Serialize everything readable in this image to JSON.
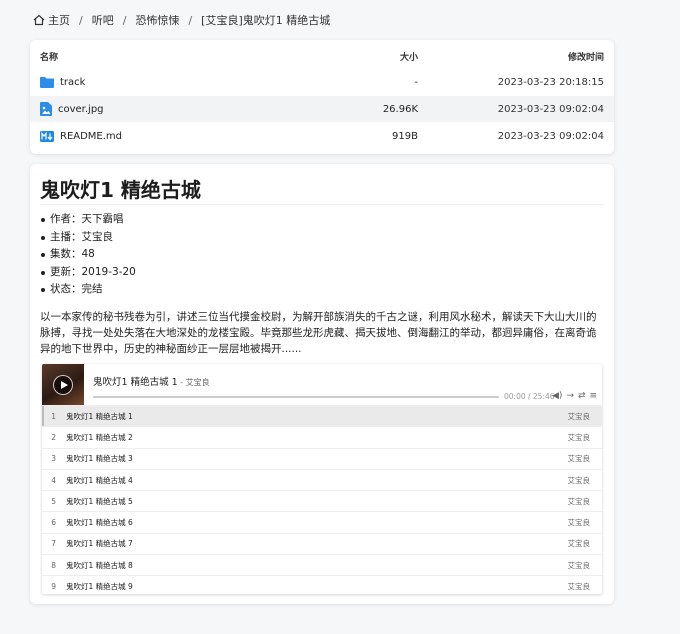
{
  "breadcrumb": {
    "home": "主页",
    "items": [
      "听吧",
      "恐怖惊悚",
      "[艾宝良]鬼吹灯1 精绝古城"
    ]
  },
  "files": {
    "headers": {
      "name": "名称",
      "size": "大小",
      "time": "修改时间"
    },
    "rows": [
      {
        "icon": "folder-icon",
        "name": "track",
        "size": "-",
        "time": "2023-03-23 20:18:15"
      },
      {
        "icon": "image-file-icon",
        "name": "cover.jpg",
        "size": "26.96K",
        "time": "2023-03-23 09:02:04"
      },
      {
        "icon": "markdown-icon",
        "name": "README.md",
        "size": "919B",
        "time": "2023-03-23 09:02:04"
      }
    ]
  },
  "readme": {
    "title": "鬼吹灯1 精绝古城",
    "items": [
      "作者：天下霸唱",
      "主播：艾宝良",
      "集数：48",
      "更新：2019-3-20",
      "状态：完结"
    ],
    "description": "以一本家传的秘书残卷为引，讲述三位当代摸金校尉，为解开部族消失的千古之谜，利用风水秘术，解读天下大山大川的脉搏，寻找一处处失落在大地深处的龙楼宝殿。毕竟那些龙形虎藏、揭天拔地、倒海翻江的举动，都迥异庸俗，在离奇诡异的地下世界中，历史的神秘面纱正一层层地被揭开......"
  },
  "player": {
    "title": "鬼吹灯1 精绝古城 1",
    "artist": " - 艾宝良",
    "time": "00:00 / 25:46",
    "progress": 0,
    "tracks": [
      {
        "num": "1",
        "name": "鬼吹灯1 精绝古城 1",
        "artist": "艾宝良"
      },
      {
        "num": "2",
        "name": "鬼吹灯1 精绝古城 2",
        "artist": "艾宝良"
      },
      {
        "num": "3",
        "name": "鬼吹灯1 精绝古城 3",
        "artist": "艾宝良"
      },
      {
        "num": "4",
        "name": "鬼吹灯1 精绝古城 4",
        "artist": "艾宝良"
      },
      {
        "num": "5",
        "name": "鬼吹灯1 精绝古城 5",
        "artist": "艾宝良"
      },
      {
        "num": "6",
        "name": "鬼吹灯1 精绝古城 6",
        "artist": "艾宝良"
      },
      {
        "num": "7",
        "name": "鬼吹灯1 精绝古城 7",
        "artist": "艾宝良"
      },
      {
        "num": "8",
        "name": "鬼吹灯1 精绝古城 8",
        "artist": "艾宝良"
      },
      {
        "num": "9",
        "name": "鬼吹灯1 精绝古城 9",
        "artist": "艾宝良"
      }
    ]
  },
  "colors": {
    "folder": "#2b8de8",
    "markdown": "#1e88e5",
    "image": "#2b8de8"
  }
}
